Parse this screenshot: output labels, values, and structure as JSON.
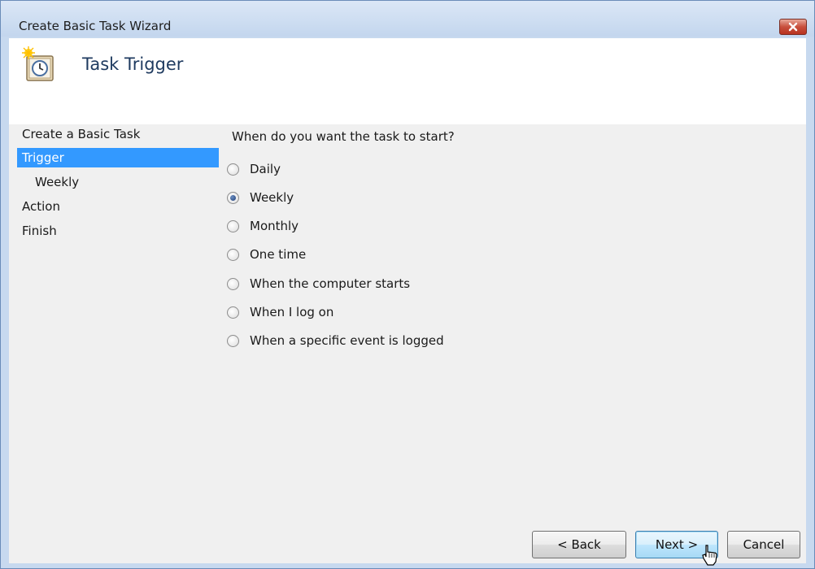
{
  "window": {
    "title": "Create Basic Task Wizard"
  },
  "header": {
    "title": "Task Trigger",
    "icon": "clock-calendar-icon"
  },
  "nav": {
    "items": [
      {
        "label": "Create a Basic Task"
      },
      {
        "label": "Trigger",
        "selected": true
      },
      {
        "label": "Weekly"
      },
      {
        "label": "Action"
      },
      {
        "label": "Finish"
      }
    ]
  },
  "main": {
    "question": "When do you want the task to start?",
    "options": [
      {
        "label": "Daily",
        "checked": false
      },
      {
        "label": "Weekly",
        "checked": true
      },
      {
        "label": "Monthly",
        "checked": false
      },
      {
        "label": "One time",
        "checked": false
      },
      {
        "label": "When the computer starts",
        "checked": false
      },
      {
        "label": "When I log on",
        "checked": false
      },
      {
        "label": "When a specific event is logged",
        "checked": false
      }
    ]
  },
  "buttons": {
    "back": "< Back",
    "next": "Next >",
    "cancel": "Cancel"
  },
  "colors": {
    "selection": "#3399ff",
    "close_button": "#c8503d",
    "title_bar": "#c7d9ef"
  }
}
